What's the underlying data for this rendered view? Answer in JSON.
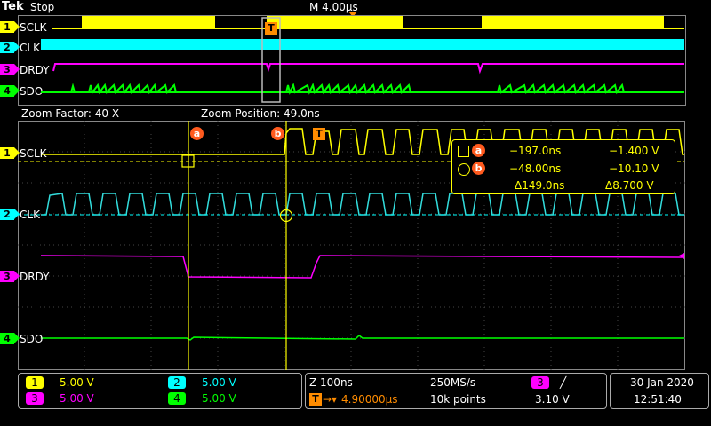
{
  "header": {
    "brand": "Tek",
    "run_state": "Stop",
    "timebase": "M 4.00µs"
  },
  "overview": {
    "ch1_label": "SCLK",
    "ch2_label": "CLK",
    "ch3_label": "DRDY",
    "ch4_label": "SDO",
    "trigger_marker": "T"
  },
  "zoom": {
    "factor": "Zoom Factor: 40 X",
    "position": "Zoom Position: 49.0ns",
    "ch1_label": "SCLK",
    "ch2_label": "CLK",
    "ch3_label": "DRDY",
    "ch4_label": "SDO",
    "cursor_a": "a",
    "cursor_b": "b",
    "trigger_marker": "T"
  },
  "channels": [
    {
      "num": "1",
      "color": "#ffff00",
      "scale": "5.00 V"
    },
    {
      "num": "2",
      "color": "#00ffff",
      "scale": "5.00 V"
    },
    {
      "num": "3",
      "color": "#ff00ff",
      "scale": "5.00 V"
    },
    {
      "num": "4",
      "color": "#00ff00",
      "scale": "5.00 V"
    }
  ],
  "cursor_readout": {
    "a_time": "−197.0ns",
    "a_volt": "−1.400 V",
    "b_time": "−48.00ns",
    "b_volt": "−10.10 V",
    "delta_time": "Δ149.0ns",
    "delta_volt": "Δ8.700 V"
  },
  "acquisition": {
    "zoom_scale": "Z 100ns",
    "sample_rate": "250MS/s",
    "trigger_delay": "4.90000µs",
    "record_length": "10k points",
    "trigger_channel": "3",
    "trigger_slope": "╱",
    "trigger_level": "3.10 V"
  },
  "datetime": {
    "date": "30 Jan  2020",
    "time": "12:51:40"
  },
  "colors": {
    "ch1": "#ffff00",
    "ch2": "#00ffff",
    "ch3": "#ff00ff",
    "ch4": "#00ff00",
    "trigger": "#ff8c00",
    "cursor_badge": "#ff5a1e"
  }
}
